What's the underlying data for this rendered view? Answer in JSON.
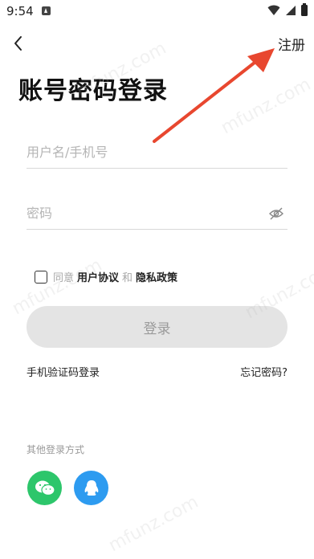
{
  "status_bar": {
    "time": "9:54"
  },
  "header": {
    "register_label": "注册"
  },
  "page_title": "账号密码登录",
  "form": {
    "username_placeholder": "用户名/手机号",
    "password_placeholder": "密码"
  },
  "agreement": {
    "prefix": "同意",
    "user_agreement": "用户协议",
    "and": "和",
    "privacy_policy": "隐私政策"
  },
  "login_button": "登录",
  "links": {
    "sms_login": "手机验证码登录",
    "forgot_password": "忘记密码?"
  },
  "other_login": {
    "title": "其他登录方式",
    "wechat_color": "#2dc66b",
    "qq_color": "#2d9bf0"
  },
  "watermark": "mfunz.com",
  "colors": {
    "annotation_arrow": "#e8472f",
    "button_bg": "#e4e4e4"
  }
}
